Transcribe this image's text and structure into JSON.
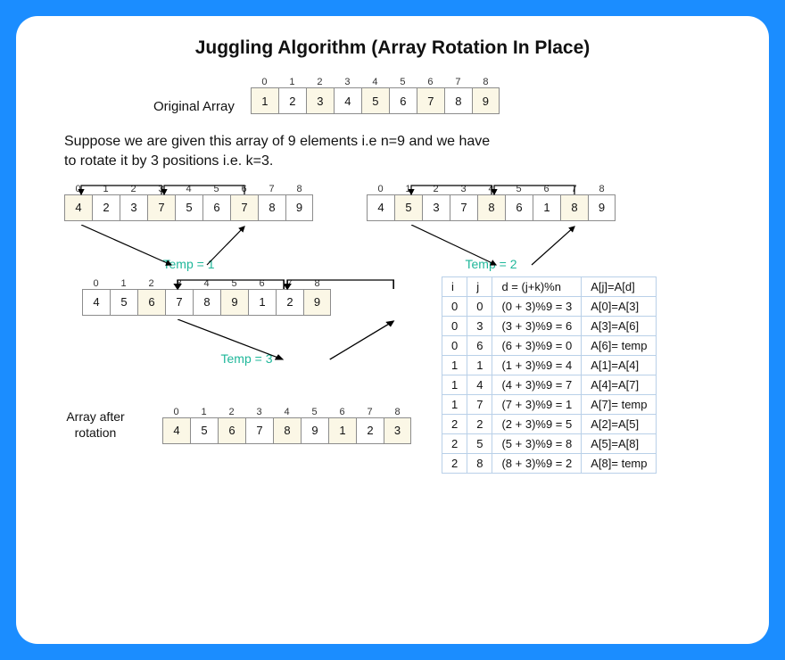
{
  "title": "Juggling Algorithm  (Array Rotation In Place)",
  "original": {
    "label": "Original Array",
    "indices": [
      "0",
      "1",
      "2",
      "3",
      "4",
      "5",
      "6",
      "7",
      "8"
    ],
    "cells": [
      "1",
      "2",
      "3",
      "4",
      "5",
      "6",
      "7",
      "8",
      "9"
    ],
    "highlight": [
      0,
      2,
      4,
      6,
      8
    ]
  },
  "description": "Suppose we are given this array of 9 elements i.e n=9 and we have to rotate it by 3 positions i.e. k=3.",
  "step1": {
    "indices": [
      "0",
      "1",
      "2",
      "3",
      "4",
      "5",
      "6",
      "7",
      "8"
    ],
    "cells": [
      "4",
      "2",
      "3",
      "7",
      "5",
      "6",
      "7",
      "8",
      "9"
    ],
    "highlight": [
      0,
      3,
      6
    ],
    "temp": "Temp = 1"
  },
  "step2": {
    "indices": [
      "0",
      "1",
      "2",
      "3",
      "4",
      "5",
      "6",
      "7",
      "8"
    ],
    "cells": [
      "4",
      "5",
      "3",
      "7",
      "8",
      "6",
      "1",
      "8",
      "9"
    ],
    "highlight": [
      1,
      4,
      7
    ],
    "temp": "Temp = 2"
  },
  "step3": {
    "indices": [
      "0",
      "1",
      "2",
      "3",
      "4",
      "5",
      "6",
      "7",
      "8"
    ],
    "cells": [
      "4",
      "5",
      "6",
      "7",
      "8",
      "9",
      "1",
      "2",
      "9"
    ],
    "highlight": [
      2,
      5,
      8
    ],
    "temp": "Temp =  3"
  },
  "final": {
    "label": "Array after rotation",
    "indices": [
      "0",
      "1",
      "2",
      "3",
      "4",
      "5",
      "6",
      "7",
      "8"
    ],
    "cells": [
      "4",
      "5",
      "6",
      "7",
      "8",
      "9",
      "1",
      "2",
      "3"
    ],
    "highlight": [
      0,
      2,
      4,
      6,
      8
    ]
  },
  "table": {
    "headers": [
      "i",
      "j",
      "d = (j+k)%n",
      "A[j]=A[d]"
    ],
    "rows": [
      [
        "0",
        "0",
        "(0 + 3)%9 = 3",
        "A[0]=A[3]"
      ],
      [
        "0",
        "3",
        "(3 + 3)%9 = 6",
        "A[3]=A[6]"
      ],
      [
        "0",
        "6",
        "(6 + 3)%9 = 0",
        "A[6]= temp"
      ],
      [
        "1",
        "1",
        "(1 + 3)%9 = 4",
        "A[1]=A[4]"
      ],
      [
        "1",
        "4",
        "(4 + 3)%9 = 7",
        "A[4]=A[7]"
      ],
      [
        "1",
        "7",
        "(7 + 3)%9 = 1",
        "A[7]= temp"
      ],
      [
        "2",
        "2",
        "(2 + 3)%9 = 5",
        "A[2]=A[5]"
      ],
      [
        "2",
        "5",
        "(5 + 3)%9 = 8",
        "A[5]=A[8]"
      ],
      [
        "2",
        "8",
        "(8 + 3)%9 = 2",
        "A[8]= temp"
      ]
    ]
  }
}
